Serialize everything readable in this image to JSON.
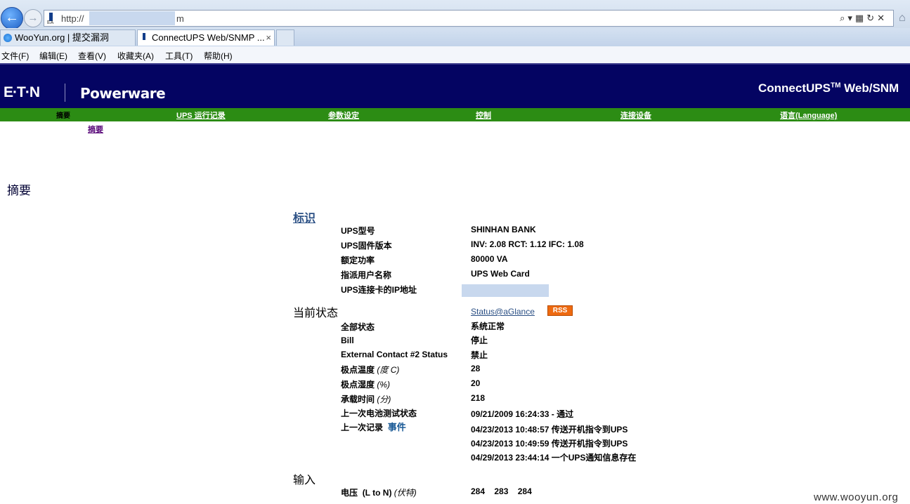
{
  "browser": {
    "url_prefix": "http://",
    "url_suffix": "m",
    "tabs": [
      {
        "label": "WooYun.org | 提交漏洞"
      },
      {
        "label": "ConnectUPS Web/SNMP ...",
        "close": "×"
      }
    ],
    "menu": [
      "文件(F)",
      "编辑(E)",
      "查看(V)",
      "收藏夹(A)",
      "工具(T)",
      "帮助(H)"
    ]
  },
  "header": {
    "brand": "E·T·N",
    "brand2": "Powerware",
    "product": "ConnectUPS",
    "product_tm": "TM",
    "product_suffix": " Web/SNM"
  },
  "nav": {
    "active": "摘要",
    "items": [
      "UPS 运行记录",
      "参数设定",
      "控制",
      "连接设备",
      "语言(Language)"
    ],
    "sub": "摘要"
  },
  "page_title": "摘要",
  "identity": {
    "heading": "标识",
    "rows": [
      {
        "label": "UPS型号",
        "value": "SHINHAN BANK"
      },
      {
        "label": "UPS固件版本",
        "value": "INV: 2.08 RCT: 1.12 IFC: 1.08"
      },
      {
        "label": "额定功率",
        "value": "80000 VA"
      },
      {
        "label": "指派用户名称",
        "value": "UPS Web Card"
      },
      {
        "label": "UPS连接卡的IP地址",
        "value": ""
      }
    ]
  },
  "status": {
    "heading": "当前状态",
    "glance_link": "Status@aGlance",
    "rss": "RSS",
    "rows": [
      {
        "label": "全部状态",
        "unit": "",
        "value": "系统正常"
      },
      {
        "label": "Bill",
        "unit": "",
        "value": "停止"
      },
      {
        "label": "External Contact #2 Status",
        "unit": "",
        "value": "禁止"
      },
      {
        "label": "极点温度",
        "unit": "(度 C)",
        "value": "28"
      },
      {
        "label": "极点湿度",
        "unit": "(%)",
        "value": "20"
      },
      {
        "label": "承载时间",
        "unit": "(分)",
        "value": "218"
      },
      {
        "label": "上一次电池测试状态",
        "unit": "",
        "value": "09/21/2009 16:24:33 - 通过"
      }
    ],
    "last_log_label": "上一次记录",
    "last_log_link": "事件",
    "log_entries": [
      "04/23/2013 10:48:57 传送开机指令到UPS",
      "04/23/2013 10:49:59 传送开机指令到UPS",
      "04/29/2013 23:44:14 一个UPS通知信息存在"
    ]
  },
  "input": {
    "heading": "输入",
    "voltage_label": "电压",
    "voltage_phase": "(L to N)",
    "voltage_unit": "(伏特)",
    "voltage_values": "284    283    284"
  },
  "watermark": "www.wooyun.org",
  "colors": {
    "banner": "#040462",
    "navbar": "#2c8c14",
    "link": "#2a4f84",
    "rss": "#ee6a10"
  }
}
